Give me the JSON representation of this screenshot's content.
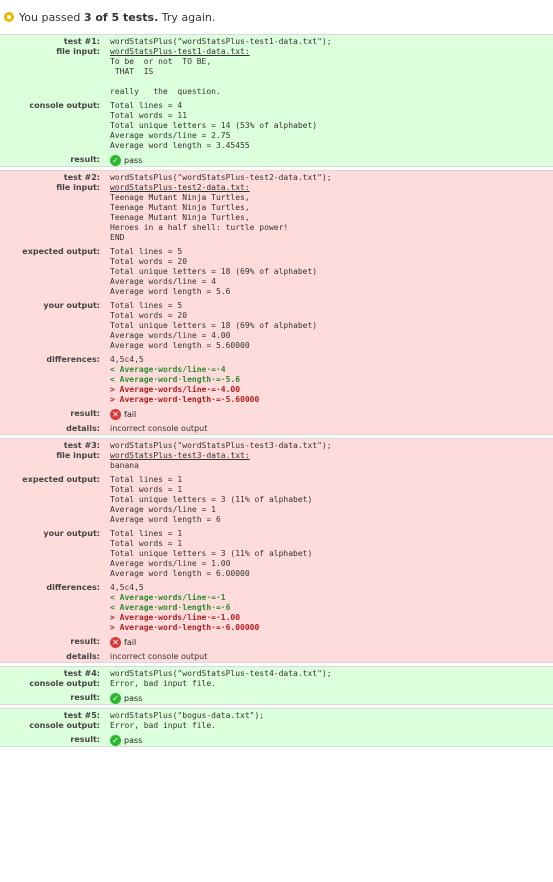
{
  "summary": {
    "prefix": "You passed ",
    "count": "3 of 5 tests.",
    "suffix": " Try again."
  },
  "labels": {
    "test": "test",
    "file_input": "file input:",
    "console_output": "console output:",
    "expected_output": "expected output:",
    "your_output": "your output:",
    "differences": "differences:",
    "result": "result:",
    "details": "details:"
  },
  "colors": {
    "pass_bg": "#dcffdc",
    "fail_bg": "#ffdcdc",
    "pass_icon": "#2cb82c",
    "fail_icon": "#d63a3a",
    "summary_icon": "#f0b400"
  },
  "tests": [
    {
      "number_label": "test #1:",
      "call": "wordStatsPlus(\"wordStatsPlus-test1-data.txt\");",
      "file_name": "wordStatsPlus-test1-data.txt:",
      "file_content": "To be  or not  TO BE,\n THAT  IS\n\nreally   the  question.",
      "console_output": "Total lines = 4\nTotal words = 11\nTotal unique letters = 14 (53% of alphabet)\nAverage words/line = 2.75\nAverage word length = 3.45455",
      "result": "pass",
      "result_icon": "check-icon"
    },
    {
      "number_label": "test #2:",
      "call": "wordStatsPlus(\"wordStatsPlus-test2-data.txt\");",
      "file_name": "wordStatsPlus-test2-data.txt:",
      "file_content": "Teenage Mutant Ninja Turtles,\nTeenage Mutant Ninja Turtles,\nTeenage Mutant Ninja Turtles,\nHeroes in a half shell: turtle power!\nEND",
      "expected_output": "Total lines = 5\nTotal words = 20\nTotal unique letters = 18 (69% of alphabet)\nAverage words/line = 4\nAverage word length = 5.6",
      "your_output": "Total lines = 5\nTotal words = 20\nTotal unique letters = 18 (69% of alphabet)\nAverage words/line = 4.00\nAverage word length = 5.60000",
      "diff_header": "4,5c4,5",
      "diff_old": [
        "< Average·words/line·=·4",
        "< Average·word·length·=·5.6"
      ],
      "diff_new": [
        "> Average·words/line·=·4.00",
        "> Average·word·length·=·5.60000"
      ],
      "result": "fail",
      "result_icon": "x-icon",
      "details": "incorrect console output"
    },
    {
      "number_label": "test #3:",
      "call": "wordStatsPlus(\"wordStatsPlus-test3-data.txt\");",
      "file_name": "wordStatsPlus-test3-data.txt:",
      "file_content": "banana",
      "expected_output": "Total lines = 1\nTotal words = 1\nTotal unique letters = 3 (11% of alphabet)\nAverage words/line = 1\nAverage word length = 6",
      "your_output": "Total lines = 1\nTotal words = 1\nTotal unique letters = 3 (11% of alphabet)\nAverage words/line = 1.00\nAverage word length = 6.00000",
      "diff_header": "4,5c4,5",
      "diff_old": [
        "< Average·words/line·=·1",
        "< Average·word·length·=·6"
      ],
      "diff_new": [
        "> Average·words/line·=·1.00",
        "> Average·word·length·=·6.00000"
      ],
      "result": "fail",
      "result_icon": "x-icon",
      "details": "incorrect console output"
    },
    {
      "number_label": "test #4:",
      "call": "wordStatsPlus(\"wordStatsPlus-test4-data.txt\");",
      "console_output": "Error, bad input file.",
      "result": "pass",
      "result_icon": "check-icon"
    },
    {
      "number_label": "test #5:",
      "call": "wordStatsPlus(\"bogus-data.txt\");",
      "console_output": "Error, bad input file.",
      "result": "pass",
      "result_icon": "check-icon"
    }
  ]
}
